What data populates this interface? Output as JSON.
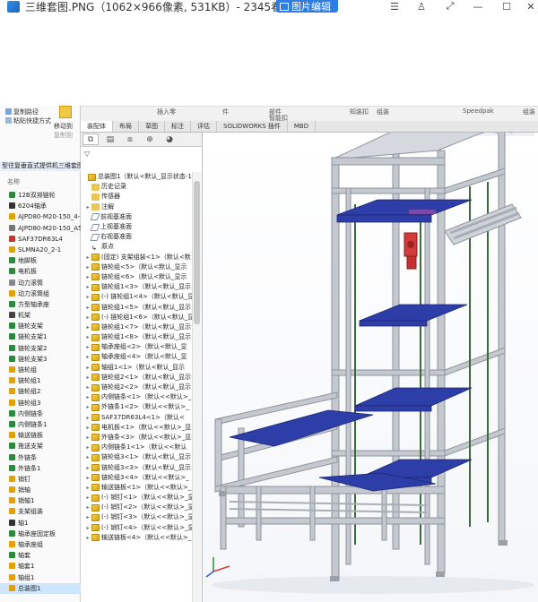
{
  "viewer": {
    "title": "三维套图.PNG（1062×966像素, 531KB）- 2345看",
    "edit_button": "图片编辑",
    "controls": [
      "☰",
      "♙",
      "⤢",
      "—",
      "☐",
      "✕"
    ]
  },
  "ribbon": {
    "top_labels": [
      "件",
      "插入零",
      "部件",
      "智能扣",
      "知装扣",
      "组装",
      "Speedpak",
      "组装"
    ],
    "tabs": [
      "装配体",
      "布局",
      "草图",
      "标注",
      "评估",
      "SOLIDWORKS 插件",
      "MBD"
    ]
  },
  "explorer": {
    "actions": [
      "复制路径",
      "粘贴快捷方式"
    ],
    "move_label": "移动到",
    "move_label2": "复制到",
    "folder_title": "型往复垂直式提供机三维套图",
    "name_header": "名称",
    "files": [
      {
        "name": "12B双排链轮",
        "color": "#2b8a3e"
      },
      {
        "name": "6204轴承",
        "color": "#333333"
      },
      {
        "name": "AJPD80-M20-150_4-",
        "color": "#e3a008"
      },
      {
        "name": "AJPD80-M20-150_A5",
        "color": "#777777"
      },
      {
        "name": "SAF37DR63L4",
        "color": "#c0392b"
      },
      {
        "name": "SLMNA20_2-1",
        "color": "#e3a008"
      },
      {
        "name": "地脚板",
        "color": "#2b8a3e"
      },
      {
        "name": "电机板",
        "color": "#2b8a3e"
      },
      {
        "name": "动力滚筒",
        "color": "#888888"
      },
      {
        "name": "动力滚筒组",
        "color": "#e3a008"
      },
      {
        "name": "方型轴承座",
        "color": "#2b8a3e"
      },
      {
        "name": "机架",
        "color": "#444444"
      },
      {
        "name": "链轮支架",
        "color": "#2b8a3e"
      },
      {
        "name": "链轮支架1",
        "color": "#2b8a3e"
      },
      {
        "name": "链轮支架2",
        "color": "#2b8a3e"
      },
      {
        "name": "链轮支架3",
        "color": "#2b8a3e"
      },
      {
        "name": "链轮组",
        "color": "#e3a008"
      },
      {
        "name": "链轮组1",
        "color": "#e3a008"
      },
      {
        "name": "链轮组2",
        "color": "#e3a008"
      },
      {
        "name": "链轮组3",
        "color": "#e3a008"
      },
      {
        "name": "内侧链条",
        "color": "#2b8a3e"
      },
      {
        "name": "内侧链条1",
        "color": "#2b8a3e"
      },
      {
        "name": "输送链板",
        "color": "#e3a008"
      },
      {
        "name": "拖送支架",
        "color": "#2b8a3e"
      },
      {
        "name": "外链条",
        "color": "#2b8a3e"
      },
      {
        "name": "外链条1",
        "color": "#2b8a3e"
      },
      {
        "name": "销钉",
        "color": "#e3a008"
      },
      {
        "name": "销轴",
        "color": "#e3a008"
      },
      {
        "name": "销轴1",
        "color": "#e3a008"
      },
      {
        "name": "支架组装",
        "color": "#e3a008"
      },
      {
        "name": "轴1",
        "color": "#333333"
      },
      {
        "name": "轴承座固定板",
        "color": "#2b8a3e"
      },
      {
        "name": "轴承座组",
        "color": "#e3a008"
      },
      {
        "name": "轴套",
        "color": "#2b8a3e"
      },
      {
        "name": "轴套1",
        "color": "#e3a008"
      },
      {
        "name": "轴组1",
        "color": "#e3a008"
      },
      {
        "name": "总装图1",
        "color": "#e3a008"
      }
    ]
  },
  "tree": {
    "tab_icons": [
      "⧉",
      "▤",
      "⧈",
      "⊕",
      "◕"
    ],
    "filter_icon": "▽",
    "rows": [
      {
        "label": "总装图1（默认<默认_显示状态-1>",
        "icon": "assy",
        "arrow": ""
      },
      {
        "label": "历史记录",
        "icon": "folder",
        "arrow": ""
      },
      {
        "label": "传感器",
        "icon": "folder",
        "arrow": ""
      },
      {
        "label": "注解",
        "icon": "folder",
        "arrow": "▸"
      },
      {
        "label": "前视基准面",
        "icon": "plane",
        "arrow": ""
      },
      {
        "label": "上视基准面",
        "icon": "plane",
        "arrow": ""
      },
      {
        "label": "右视基准面",
        "icon": "plane",
        "arrow": ""
      },
      {
        "label": "原点",
        "icon": "origin",
        "arrow": ""
      },
      {
        "label": "(固定) 支架组装<1>（默认<默",
        "icon": "assy",
        "arrow": "▸"
      },
      {
        "label": "链轮组<5>（默认<默认_显示",
        "icon": "assy",
        "arrow": "▸"
      },
      {
        "label": "链轮组<6>（默认<默认_显示",
        "icon": "assy",
        "arrow": "▸"
      },
      {
        "label": "链轮组1<3>（默认<默认_显示",
        "icon": "assy",
        "arrow": "▸"
      },
      {
        "label": "(-) 链轮组1<4>（默认<默认_显",
        "icon": "assy",
        "arrow": "▸"
      },
      {
        "label": "链轮组1<5>（默认<默认_显示",
        "icon": "assy",
        "arrow": "▸"
      },
      {
        "label": "(-) 链轮组1<6>（默认<默认_显",
        "icon": "assy",
        "arrow": "▸"
      },
      {
        "label": "链轮组1<7>（默认<默认_显示",
        "icon": "assy",
        "arrow": "▸"
      },
      {
        "label": "链轮组1<8>（默认<默认_显示",
        "icon": "assy",
        "arrow": "▸"
      },
      {
        "label": "轴承座组<2>（默认<默认_显",
        "icon": "assy",
        "arrow": "▸"
      },
      {
        "label": "轴承座组<4>（默认<默认_显",
        "icon": "assy",
        "arrow": "▸"
      },
      {
        "label": "轴组1<1>（默认<默认_显示",
        "icon": "assy",
        "arrow": "▸"
      },
      {
        "label": "链轮组2<1>（默认<默认_显示",
        "icon": "assy",
        "arrow": "▸"
      },
      {
        "label": "链轮组2<2>（默认<默认_显示",
        "icon": "assy",
        "arrow": "▸"
      },
      {
        "label": "内侧链条<1>（默认<<默认>_",
        "icon": "assy",
        "arrow": "▸"
      },
      {
        "label": "外链条1<2>（默认<<默认>_",
        "icon": "assy",
        "arrow": "▸"
      },
      {
        "label": "SAF37DR63L4<1>（默认<",
        "icon": "assy",
        "arrow": "▸"
      },
      {
        "label": "电机板<1>（默认<<默认>_显",
        "icon": "assy",
        "arrow": "▸"
      },
      {
        "label": "外链条<3>（默认<<默认>_显",
        "icon": "assy",
        "arrow": "▸"
      },
      {
        "label": "内侧链条1<1>（默认<<默认",
        "icon": "assy",
        "arrow": "▸"
      },
      {
        "label": "链轮组3<1>（默认<默认_显示",
        "icon": "assy",
        "arrow": "▸"
      },
      {
        "label": "链轮组3<3>（默认<默认_显示",
        "icon": "assy",
        "arrow": "▸"
      },
      {
        "label": "链轮组3<4>（默认<<默认>_",
        "icon": "assy",
        "arrow": "▸"
      },
      {
        "label": "输送链板<1>（默认<<默认>_",
        "icon": "assy",
        "arrow": "▸"
      },
      {
        "label": "(-) 销钉<1>（默认<<默认>_显",
        "icon": "assy",
        "arrow": "▸"
      },
      {
        "label": "(-) 销钉<2>（默认<<默认>_显",
        "icon": "assy",
        "arrow": "▸"
      },
      {
        "label": "(-) 销钉<3>（默认<<默认>_显",
        "icon": "assy",
        "arrow": "▸"
      },
      {
        "label": "(-) 销钉<4>（默认<<默认>_显",
        "icon": "assy",
        "arrow": "▸"
      },
      {
        "label": "输送链板<4>（默认<<默认>_",
        "icon": "assy",
        "arrow": "▸"
      }
    ]
  },
  "colors": {
    "frame": "#c4c8cf",
    "frame_dark": "#8e949c",
    "conveyor": "#2e3ea8",
    "chain": "#3b6b3b",
    "motor": "#d33a3a",
    "roller": "#cfd4da",
    "accent": "#2f7de1"
  }
}
